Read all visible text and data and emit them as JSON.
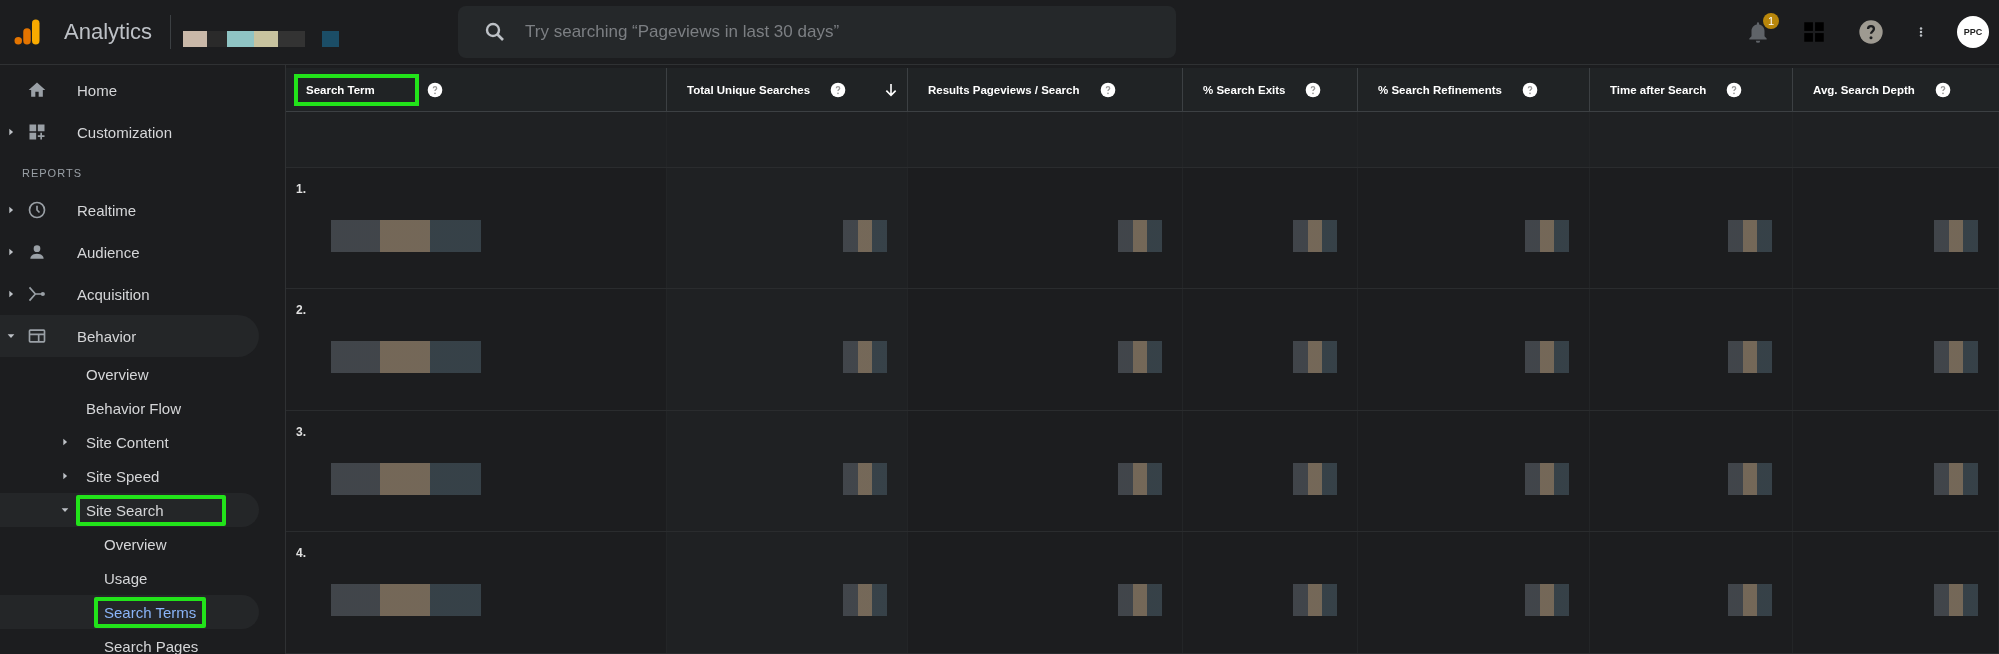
{
  "app": {
    "title": "Analytics"
  },
  "search": {
    "placeholder": "Try searching “Pageviews in last 30 days”"
  },
  "notifications": {
    "count": "1"
  },
  "avatar": {
    "label": "PPC"
  },
  "sidebar": {
    "items": [
      {
        "label": "Home",
        "selected": false,
        "highlighted": false
      },
      {
        "label": "Customization",
        "expanded": false,
        "selected": false,
        "highlighted": false
      },
      {
        "kind": "heading",
        "label": "REPORTS"
      },
      {
        "label": "Realtime",
        "expanded": false,
        "selected": false,
        "highlighted": false
      },
      {
        "label": "Audience",
        "expanded": false,
        "selected": false,
        "highlighted": false
      },
      {
        "label": "Acquisition",
        "expanded": false,
        "selected": false,
        "highlighted": false
      },
      {
        "label": "Behavior",
        "expanded": true,
        "selected": false,
        "highlighted": false,
        "children": [
          {
            "label": "Overview",
            "selected": false,
            "highlighted": false
          },
          {
            "label": "Behavior Flow",
            "selected": false,
            "highlighted": false
          },
          {
            "label": "Site Content",
            "expanded": false,
            "selected": false,
            "highlighted": false
          },
          {
            "label": "Site Speed",
            "expanded": false,
            "selected": false,
            "highlighted": false
          },
          {
            "label": "Site Search",
            "expanded": true,
            "selected": false,
            "highlighted": true,
            "children": [
              {
                "label": "Overview",
                "selected": false,
                "highlighted": false
              },
              {
                "label": "Usage",
                "selected": false,
                "highlighted": false
              },
              {
                "label": "Search Terms",
                "selected": true,
                "highlighted": true
              },
              {
                "label": "Search Pages",
                "selected": false,
                "highlighted": false
              }
            ]
          }
        ]
      }
    ]
  },
  "table": {
    "columns": [
      {
        "label": "Search Term",
        "sorted": false,
        "highlighted": true
      },
      {
        "label": "Total Unique Searches",
        "sorted": true,
        "highlighted": false
      },
      {
        "label": "Results Pageviews / Search",
        "sorted": false,
        "highlighted": false
      },
      {
        "label": "% Search Exits",
        "sorted": false,
        "highlighted": false
      },
      {
        "label": "% Search Refinements",
        "sorted": false,
        "highlighted": false
      },
      {
        "label": "Time after Search",
        "sorted": false,
        "highlighted": false
      },
      {
        "label": "Avg. Search Depth",
        "sorted": false,
        "highlighted": false
      }
    ],
    "rows": [
      {
        "index": "1."
      },
      {
        "index": "2."
      },
      {
        "index": "3."
      },
      {
        "index": "4."
      }
    ]
  }
}
